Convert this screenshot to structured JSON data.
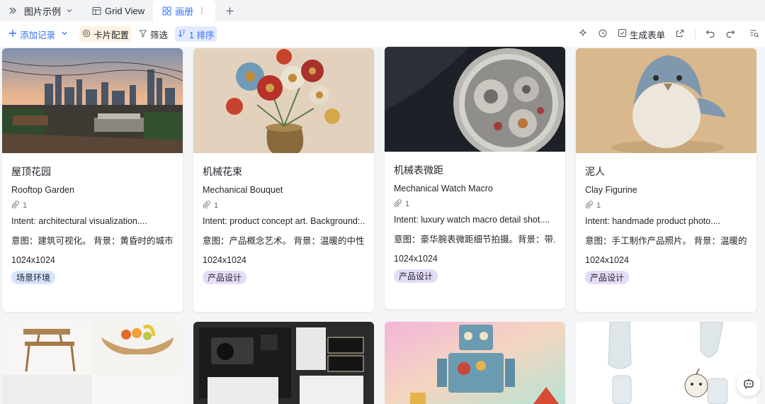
{
  "tabs": {
    "table_name": "图片示例",
    "grid_view": "Grid View",
    "gallery_view": "画册"
  },
  "toolbar": {
    "add_record": "添加记录",
    "card_config": "卡片配置",
    "filter": "筛选",
    "sort": "1 排序",
    "generate_form": "生成表单"
  },
  "cards": [
    {
      "title": "屋顶花园",
      "subtitle": "Rooftop Garden",
      "attachments": "1",
      "intent": "Intent: architectural visualization....",
      "intent_cn": "意图：建筑可视化。 背景：黄昏时的城市...",
      "size": "1024x1024",
      "tag": "场景环境"
    },
    {
      "title": "机械花束",
      "subtitle": "Mechanical Bouquet",
      "attachments": "1",
      "intent": "Intent: product concept art. Background:...",
      "intent_cn": "意图：产品概念艺术。 背景：温暖的中性...",
      "size": "1024x1024",
      "tag": "产品设计"
    },
    {
      "title": "机械表微距",
      "subtitle": "Mechanical Watch Macro",
      "attachments": "1",
      "intent": "Intent: luxury watch macro detail shot....",
      "intent_cn": "意图：豪华腕表微距细节拍摄。背景：带...",
      "size": "1024x1024",
      "tag": "产品设计"
    },
    {
      "title": "泥人",
      "subtitle": "Clay Figurine",
      "attachments": "1",
      "intent": "Intent: handmade product photo....",
      "intent_cn": "意图：手工制作产品照片。 背景：温暖的...",
      "size": "1024x1024",
      "tag": "产品设计"
    }
  ],
  "colors": {
    "accent": "#3370ff",
    "scene_tag": "#d6e4ff",
    "product_tag": "#e6dcf7"
  }
}
